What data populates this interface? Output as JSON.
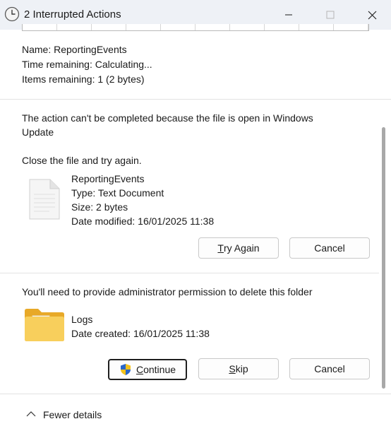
{
  "window": {
    "title": "2 Interrupted Actions",
    "icon": "clock-icon",
    "minimize_icon": "minimize-icon",
    "maximize_icon": "maximize-icon",
    "close_icon": "close-icon"
  },
  "summary": {
    "name_label": "Name:",
    "name_value": "ReportingEvents",
    "time_label": "Time remaining:",
    "time_value": "Calculating...",
    "items_label": "Items remaining:",
    "items_value": "1 (2 bytes)"
  },
  "file_conflict": {
    "message_line1": "The action can't be completed because the file is open in Windows",
    "message_line2": "Update",
    "instruction": "Close the file and try again.",
    "file_icon": "text-document-icon",
    "file_name": "ReportingEvents",
    "file_type": "Type: Text Document",
    "file_size": "Size: 2 bytes",
    "file_modified": "Date modified: 16/01/2025 11:38",
    "try_again_mnemonic": "T",
    "try_again_rest": "ry Again",
    "cancel_label": "Cancel"
  },
  "permission": {
    "message": "You'll need to provide administrator permission to delete this folder",
    "folder_icon": "folder-icon",
    "folder_name": "Logs",
    "folder_created": "Date created: 16/01/2025 11:38",
    "continue_icon": "uac-shield-icon",
    "continue_mnemonic": "C",
    "continue_rest": "ontinue",
    "skip_mnemonic": "S",
    "skip_rest": "kip",
    "cancel_label": "Cancel"
  },
  "footer": {
    "toggle_icon": "chevron-up-icon",
    "toggle_label": "Fewer details"
  },
  "colors": {
    "titlebar_bg": "#eef1f6",
    "divider": "#e3e3e3",
    "button_border": "#c9c9c9"
  }
}
